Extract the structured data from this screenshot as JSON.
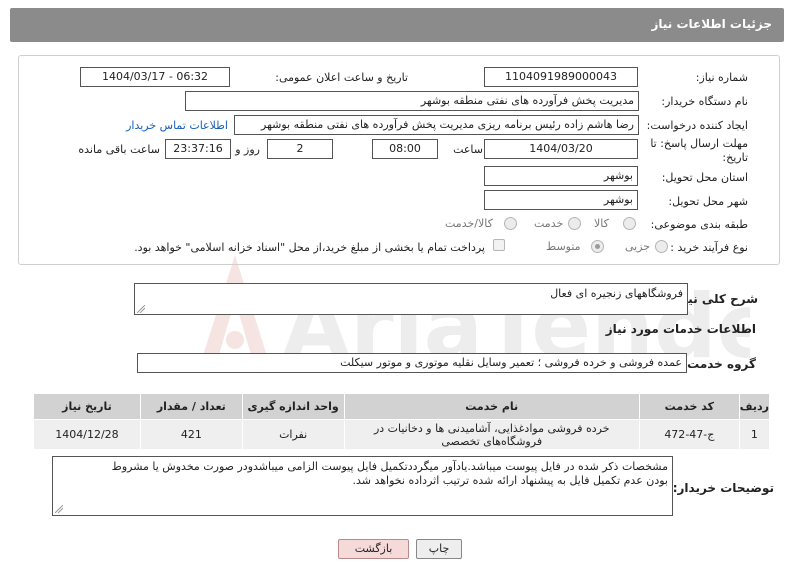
{
  "header": {
    "title": "جزئیات اطلاعات نیاز"
  },
  "fields": {
    "need_number_label": "شماره نیاز:",
    "need_number": "1104091989000043",
    "announce_label": "تاریخ و ساعت اعلان عمومی:",
    "announce_value": "1404/03/17 - 06:32",
    "buyer_org_label": "نام دستگاه خریدار:",
    "buyer_org": "مدیریت پخش فرآورده های نفتی منطقه بوشهر",
    "creator_label": "ایجاد کننده درخواست:",
    "creator": "رضا هاشم زاده رئیس برنامه ریزی مدیریت پخش فرآورده های نفتی منطقه بوشهر",
    "contact_link": "اطلاعات تماس خریدار",
    "deadline_label_1": "مهلت ارسال پاسخ: تا",
    "deadline_label_2": "تاریخ:",
    "deadline_date": "1404/03/20",
    "time_label": "ساعت",
    "deadline_time": "08:00",
    "days_value": "2",
    "days_label": "روز و",
    "remaining_time": "23:37:16",
    "remaining_label": "ساعت باقی مانده",
    "province_label": "استان محل تحویل:",
    "province": "بوشهر",
    "city_label": "شهر محل تحویل:",
    "city": "بوشهر",
    "category_label": "طبقه بندی موضوعی:",
    "category_options": [
      "کالا",
      "خدمت",
      "کالا/خدمت"
    ],
    "purchase_type_label": "نوع فرآیند خرید :",
    "purchase_options": [
      "جزیی",
      "متوسط"
    ],
    "payment_note": "پرداخت تمام یا بخشی از مبلغ خرید،از محل \"اسناد خزانه اسلامی\" خواهد بود."
  },
  "summary": {
    "label": "شرح کلی نیاز:",
    "value": "فروشگاههای زنجیره ای فعال"
  },
  "services": {
    "section_title": "اطلاعات خدمات مورد نیاز",
    "group_label": "گروه خدمت:",
    "group_value": "عمده فروشی و خرده فروشی ؛ تعمیر وسایل نقلیه موتوری و موتور سیکلت",
    "columns": [
      "ردیف",
      "کد خدمت",
      "نام خدمت",
      "واحد اندازه گیری",
      "تعداد / مقدار",
      "تاریخ نیاز"
    ],
    "rows": [
      {
        "row": "1",
        "code": "ج-47-472",
        "name_1": "خرده فروشی موادغذایی، آشامیدنی ها و دخانیات در",
        "name_2": "فروشگاه‌های تخصصی",
        "unit": "نفرات",
        "qty": "421",
        "date": "1404/12/28"
      }
    ]
  },
  "buyer_notes": {
    "label": "توضیحات خریدار:",
    "line_1": "مشخصات ذکر شده در فایل پیوست میباشد.یادآور میگرددتکمیل فایل پیوست الزامی میباشدودر صورت مخدوش یا مشروط",
    "line_2": "بودن عدم تکمیل فایل به پیشنهاد ارائه شده ترتیب اثرداده نخواهد شد."
  },
  "buttons": {
    "print": "چاپ",
    "back": "بازگشت"
  },
  "watermark": {
    "text": "AriaTender.neT"
  }
}
